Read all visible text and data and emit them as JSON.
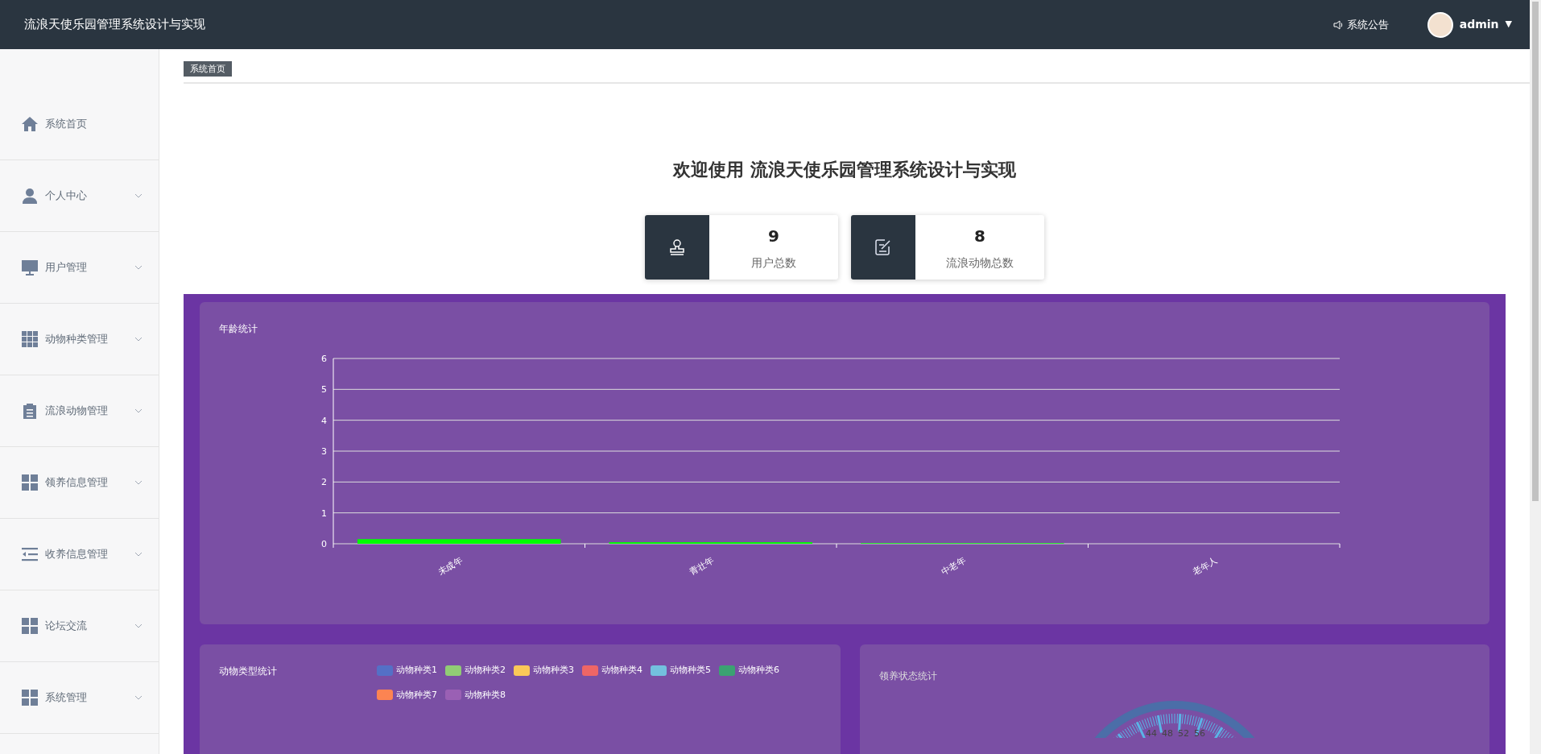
{
  "header": {
    "title": "流浪天使乐园管理系统设计与实现",
    "notice": "系统公告",
    "user": "admin",
    "caret": "▼"
  },
  "sidebar": {
    "items": [
      {
        "label": "系统首页",
        "expandable": false
      },
      {
        "label": "个人中心",
        "expandable": true
      },
      {
        "label": "用户管理",
        "expandable": true
      },
      {
        "label": "动物种类管理",
        "expandable": true
      },
      {
        "label": "流浪动物管理",
        "expandable": true
      },
      {
        "label": "领养信息管理",
        "expandable": true
      },
      {
        "label": "收养信息管理",
        "expandable": true
      },
      {
        "label": "论坛交流",
        "expandable": true
      },
      {
        "label": "系统管理",
        "expandable": true
      }
    ]
  },
  "breadcrumb": "系统首页",
  "welcome": "欢迎使用 流浪天使乐园管理系统设计与实现",
  "stats": [
    {
      "value": "9",
      "label": "用户总数"
    },
    {
      "value": "8",
      "label": "流浪动物总数"
    }
  ],
  "age_chart": {
    "title": "年龄统计",
    "chart_data": {
      "type": "bar",
      "categories": [
        "未成年",
        "青壮年",
        "中老年",
        "老年人"
      ],
      "series": [
        {
          "color": "#00ff00",
          "values": [
            0.15,
            0.05,
            0.02,
            0
          ]
        }
      ],
      "ylim": [
        0,
        6
      ],
      "yticks": [
        0,
        1,
        2,
        3,
        4,
        5,
        6
      ],
      "grid": true
    }
  },
  "type_chart": {
    "title": "动物类型统计",
    "legend": [
      {
        "label": "动物种类1",
        "color": "#5470c6"
      },
      {
        "label": "动物种类2",
        "color": "#91cc75"
      },
      {
        "label": "动物种类3",
        "color": "#fac858"
      },
      {
        "label": "动物种类4",
        "color": "#ee6666"
      },
      {
        "label": "动物种类5",
        "color": "#73c0de"
      },
      {
        "label": "动物种类6",
        "color": "#3ba272"
      },
      {
        "label": "动物种类7",
        "color": "#fc8452"
      },
      {
        "label": "动物种类8",
        "color": "#9a60b4"
      }
    ]
  },
  "status_chart": {
    "title": "领养状态统计",
    "gauge_labels": [
      "44",
      "48",
      "52",
      "56"
    ]
  }
}
